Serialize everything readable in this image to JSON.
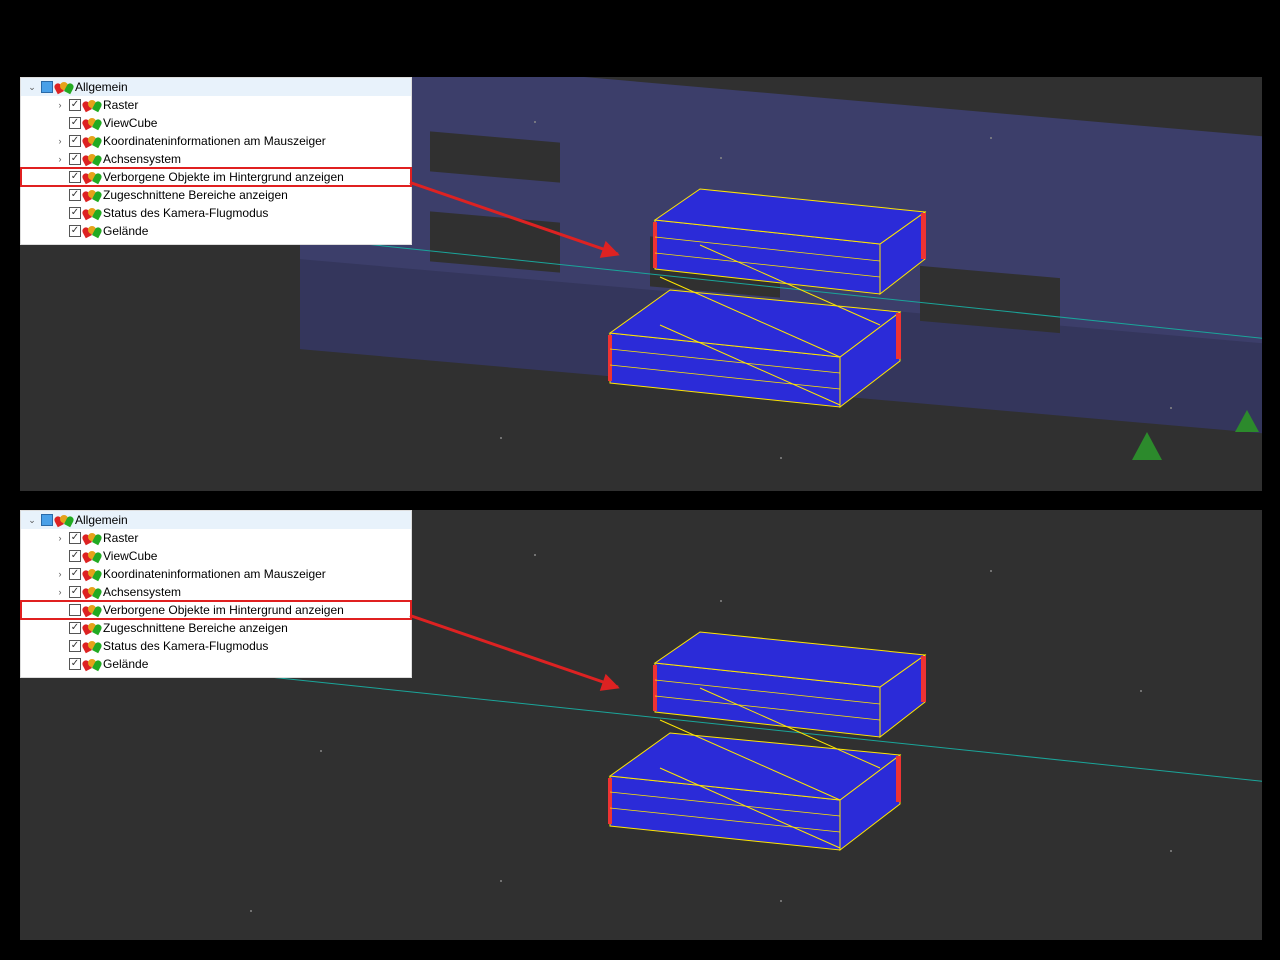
{
  "panels": {
    "top": {
      "root": {
        "label": "Allgemein",
        "checked": "partial",
        "expanded": true,
        "hasArrow": true
      },
      "items": [
        {
          "label": "Raster",
          "checked": true,
          "hasArrow": true
        },
        {
          "label": "ViewCube",
          "checked": true,
          "hasArrow": false
        },
        {
          "label": "Koordinateninformationen am Mauszeiger",
          "checked": true,
          "hasArrow": true
        },
        {
          "label": "Achsensystem",
          "checked": true,
          "hasArrow": true
        },
        {
          "label": "Verborgene Objekte im Hintergrund anzeigen",
          "checked": true,
          "hasArrow": false,
          "highlight": true
        },
        {
          "label": "Zugeschnittene Bereiche anzeigen",
          "checked": true,
          "hasArrow": false
        },
        {
          "label": "Status des Kamera-Flugmodus",
          "checked": true,
          "hasArrow": false
        },
        {
          "label": "Gelände",
          "checked": true,
          "hasArrow": false
        }
      ]
    },
    "bot": {
      "root": {
        "label": "Allgemein",
        "checked": "partial",
        "expanded": true,
        "hasArrow": true
      },
      "items": [
        {
          "label": "Raster",
          "checked": true,
          "hasArrow": true
        },
        {
          "label": "ViewCube",
          "checked": true,
          "hasArrow": false
        },
        {
          "label": "Koordinateninformationen am Mauszeiger",
          "checked": true,
          "hasArrow": true
        },
        {
          "label": "Achsensystem",
          "checked": true,
          "hasArrow": true
        },
        {
          "label": "Verborgene Objekte im Hintergrund anzeigen",
          "checked": false,
          "hasArrow": false,
          "highlight": true
        },
        {
          "label": "Zugeschnittene Bereiche anzeigen",
          "checked": true,
          "hasArrow": false
        },
        {
          "label": "Status des Kamera-Flugmodus",
          "checked": true,
          "hasArrow": false
        },
        {
          "label": "Gelände",
          "checked": true,
          "hasArrow": false
        }
      ]
    }
  },
  "glyphs": {
    "expanded": "⌄",
    "collapsed": "›",
    "check": "✓"
  }
}
